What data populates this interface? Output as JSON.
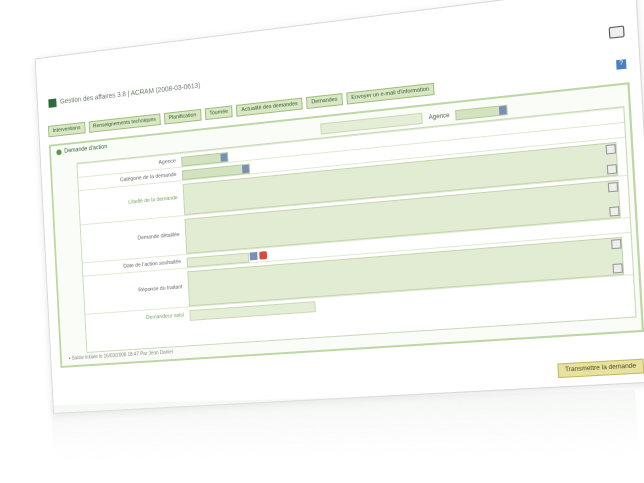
{
  "window": {
    "title": "Gestion des affaires 3.8 | ACRAM (2008-03-0613)"
  },
  "toolbar": {
    "buttons": [
      "Interventions",
      "Renseignements techniques",
      "Planification",
      "Tournée",
      "Actualité des demandes",
      "Demandes",
      "Envoyer un e-mail d'information"
    ]
  },
  "panel": {
    "heading": "Demande d'action",
    "top_label": "Agence"
  },
  "form": {
    "rows": [
      {
        "label": "Agence"
      },
      {
        "label": "Catégorie de la demande"
      },
      {
        "label": "Libellé de la demande"
      },
      {
        "label": "Demande détaillée"
      },
      {
        "label": "Date de l'action souhaitée"
      },
      {
        "label": "Réponse du traitant"
      },
      {
        "label": "Demandeur saisi"
      }
    ]
  },
  "footer": {
    "note": "Saisie initiale le 16/03/2008 18:47 Par Jean Daniel"
  },
  "actions": {
    "submit_label": "Transmettre la demande"
  }
}
